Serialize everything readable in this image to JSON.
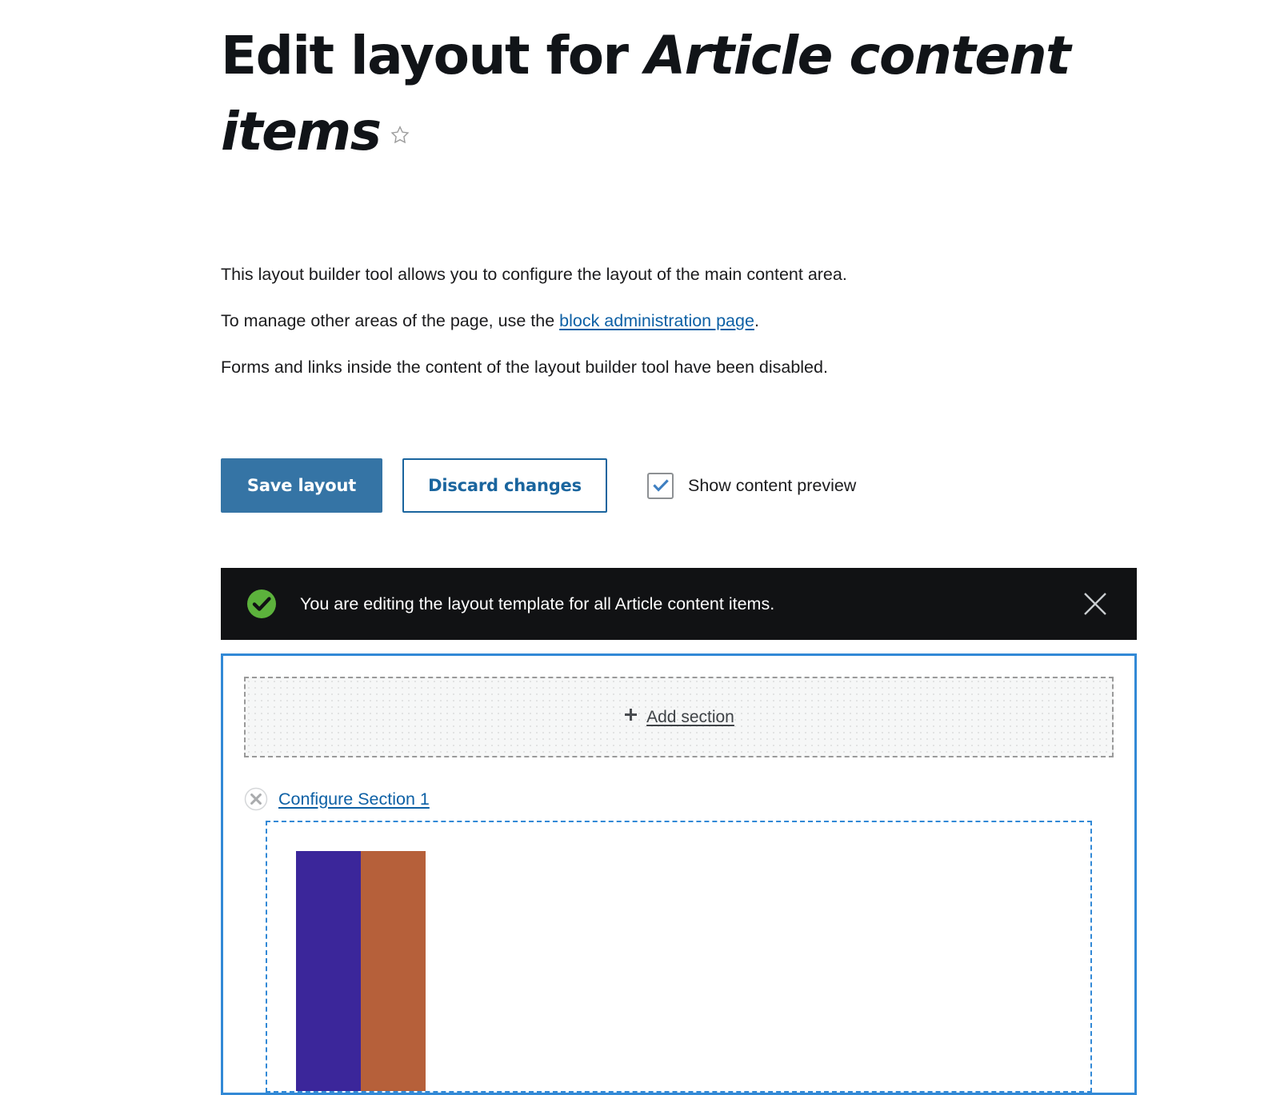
{
  "page": {
    "title_prefix": "Edit layout for ",
    "title_emphasis": "Article content items",
    "star_icon": "star-outline-icon"
  },
  "intro": {
    "paragraph_1": "This layout builder tool allows you to configure the layout of the main content area.",
    "paragraph_2_before": "To manage other areas of the page, use the ",
    "paragraph_2_link": "block administration page",
    "paragraph_2_after": ".",
    "paragraph_3": "Forms and links inside the content of the layout builder tool have been disabled."
  },
  "actions": {
    "save_label": "Save layout",
    "discard_label": "Discard changes",
    "preview_checkbox_label": "Show content preview",
    "preview_checked": true,
    "primary_color": "#3574a5",
    "secondary_color": "#1a659e"
  },
  "status": {
    "icon": "check-circle-icon",
    "message": "You are editing the layout template for all Article content items.",
    "close_icon": "close-icon",
    "background": "#111214",
    "icon_color": "#5cb23c"
  },
  "builder": {
    "border_color": "#3289d6",
    "add_section": {
      "icon": "plus-icon",
      "label": "Add section"
    },
    "sections": [
      {
        "remove_icon": "remove-circle-icon",
        "configure_label": "Configure Section 1",
        "region_border_color": "#3289d6",
        "blocks": [
          {
            "name": "block-indigo",
            "color": "#3b269a"
          },
          {
            "name": "block-rust",
            "color": "#b6603a"
          }
        ]
      }
    ]
  }
}
